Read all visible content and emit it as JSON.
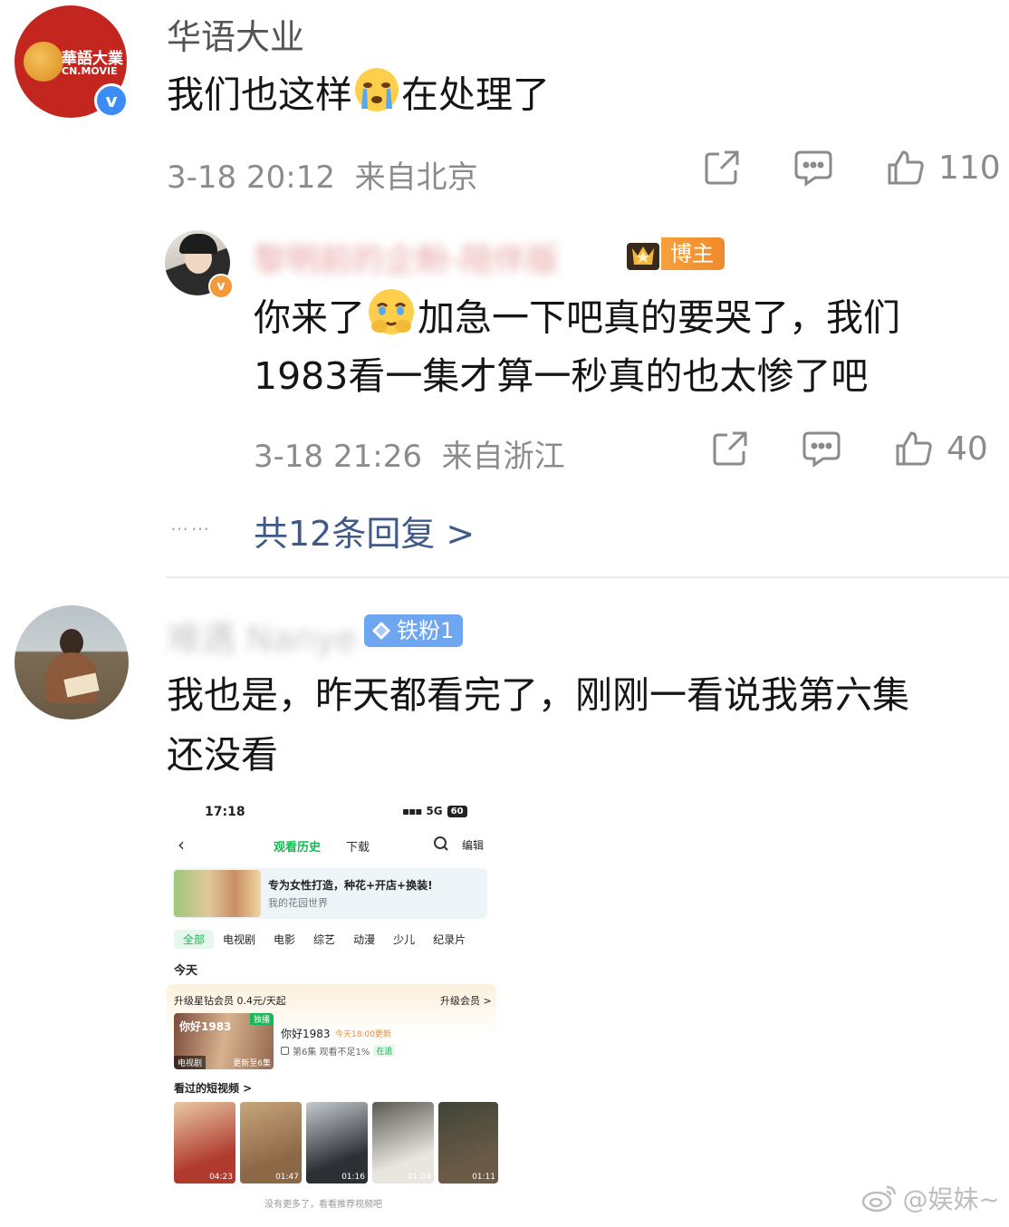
{
  "comment1": {
    "avatar_text_line1": "華語大業",
    "avatar_text_line2": "CN.MOVIE",
    "username": "华语大业",
    "content_before": "我们也这样",
    "content_after": "在处理了",
    "time": "3-18 20:12",
    "location": "来自北京",
    "likes": "110"
  },
  "reply1": {
    "username": "黎明前的企盼-陪伴版",
    "badge": "博主",
    "line1_before": "你来了",
    "line1_after": "加急一下吧真的要哭了，我们",
    "line2": "1983看一集才算一秒真的也太惨了吧",
    "time": "3-18 21:26",
    "location": "来自浙江",
    "likes": "40"
  },
  "reply_more": {
    "dots": "……",
    "label": "共12条回复 >"
  },
  "comment2": {
    "username": "难遇 Nanye",
    "badge": "铁粉1",
    "line1": "我也是，昨天都看完了，刚刚一看说我第六集",
    "line2": "还没看"
  },
  "phone": {
    "time": "17:18",
    "signal": "5G",
    "battery": "60",
    "tab_history": "观看历史",
    "tab_download": "下载",
    "edit": "编辑",
    "banner_title": "专为女性打造，种花+开店+换装!",
    "banner_sub": "我的花园世界",
    "categories": [
      "全部",
      "电视剧",
      "电影",
      "综艺",
      "动漫",
      "少儿",
      "纪录片"
    ],
    "today": "今天",
    "vip_text": "升级星钻会员 0.4元/天起",
    "vip_btn": "升级会员 >",
    "show_tag": "独播",
    "show_poster_text": "你好1983",
    "show_label": "电视剧",
    "show_ep": "更新至6集",
    "show_title": "你好1983",
    "show_update": "今天18:00更新",
    "show_progress": "第6集 观看不足1%",
    "show_status": "在追",
    "short_title": "看过的短视频 >",
    "durations": [
      "04:23",
      "01:47",
      "01:16",
      "01:04",
      "01:11"
    ],
    "footer": "没有更多了，看看推荐视频吧"
  },
  "watermark": {
    "text": "@娱妹~"
  },
  "colors": {
    "accent_green": "#19b955",
    "link_blue": "#3f5a8a",
    "verify_blue": "#3b8cf5",
    "verify_orange": "#f39a3a",
    "brand_red": "#c3261f"
  }
}
